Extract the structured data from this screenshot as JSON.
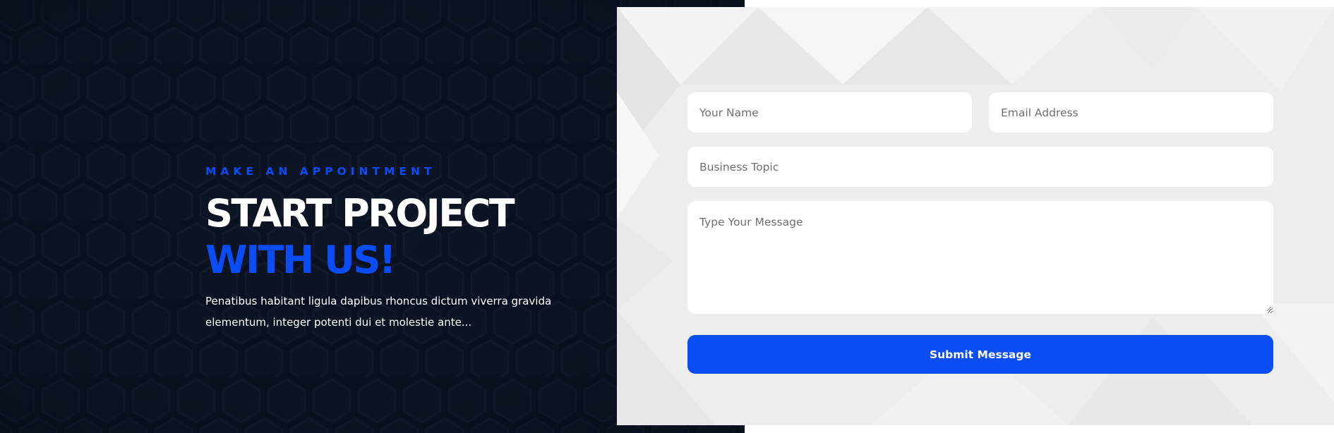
{
  "colors": {
    "accent": "#0a4df5",
    "dark_background": "#0b1120",
    "form_background": "#ededed",
    "heading_text": "#ffffff"
  },
  "intro": {
    "eyebrow": "MAKE AN APPOINTMENT",
    "headline_line1": "START PROJECT",
    "headline_line2": "WITH US!",
    "description": "Penatibus habitant ligula dapibus rhoncus dictum viverra gravida elementum, integer potenti dui et molestie ante..."
  },
  "form": {
    "name": {
      "placeholder": "Your Name",
      "value": ""
    },
    "email": {
      "placeholder": "Email Address",
      "value": ""
    },
    "topic": {
      "placeholder": "Business Topic",
      "value": ""
    },
    "message": {
      "placeholder": "Type Your Message",
      "value": ""
    },
    "submit_label": "Submit Message"
  }
}
